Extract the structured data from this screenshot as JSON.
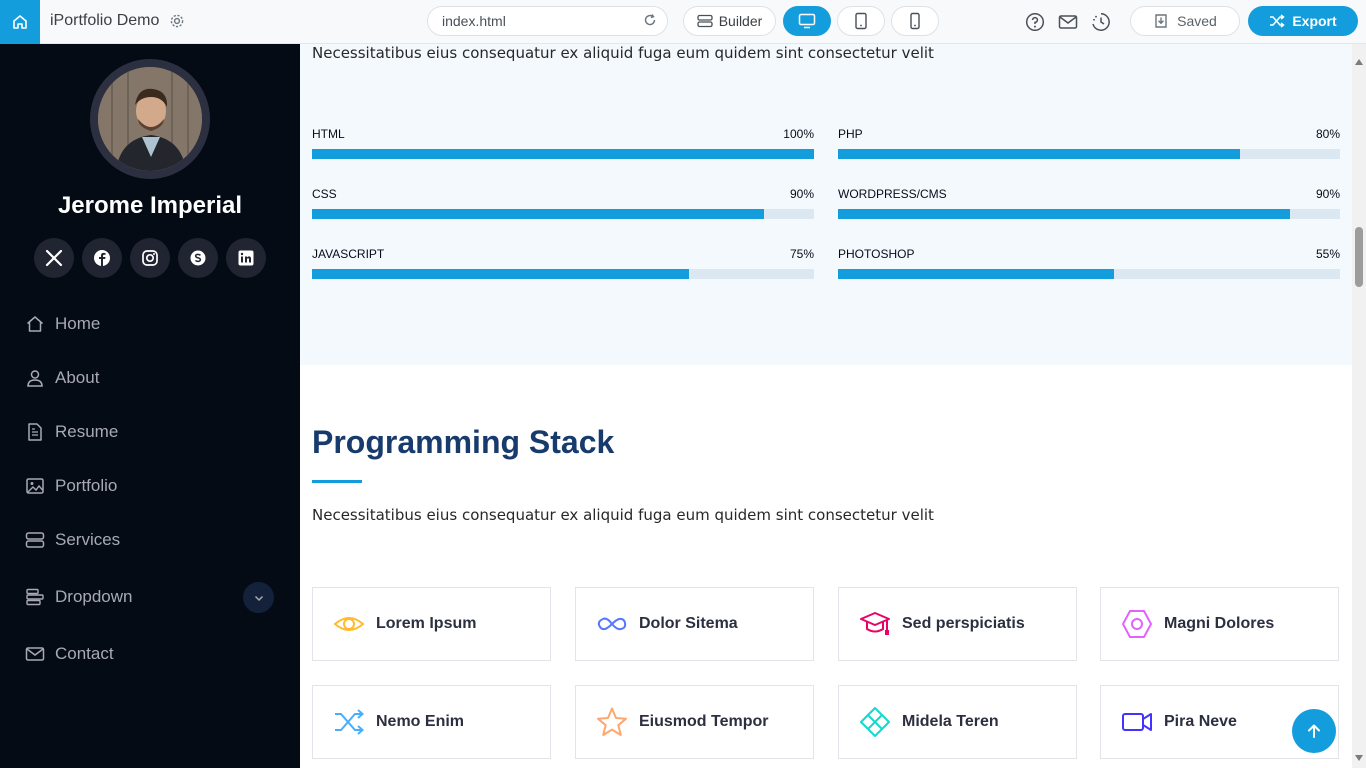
{
  "topbar": {
    "app_title": "iPortfolio Demo",
    "url": "index.html",
    "builder_label": "Builder",
    "saved_label": "Saved",
    "export_label": "Export",
    "accent": "#149ddd"
  },
  "sidebar": {
    "name": "Jerome Imperial",
    "socials": [
      "x-icon",
      "facebook-icon",
      "instagram-icon",
      "skype-icon",
      "linkedin-icon"
    ],
    "nav": [
      {
        "label": "Home",
        "icon": "home-icon"
      },
      {
        "label": "About",
        "icon": "user-icon"
      },
      {
        "label": "Resume",
        "icon": "file-icon"
      },
      {
        "label": "Portfolio",
        "icon": "image-icon"
      },
      {
        "label": "Services",
        "icon": "server-icon"
      },
      {
        "label": "Dropdown",
        "icon": "menu-icon"
      },
      {
        "label": "Contact",
        "icon": "envelope-icon"
      }
    ]
  },
  "skills": {
    "description": "Necessitatibus eius consequatur ex aliquid fuga eum quidem sint consectetur velit",
    "items": [
      {
        "name": "HTML",
        "percent": 100,
        "label": "100%"
      },
      {
        "name": "PHP",
        "percent": 80,
        "label": "80%"
      },
      {
        "name": "CSS",
        "percent": 90,
        "label": "90%"
      },
      {
        "name": "WORDPRESS/CMS",
        "percent": 90,
        "label": "90%"
      },
      {
        "name": "JAVASCRIPT",
        "percent": 75,
        "label": "75%"
      },
      {
        "name": "PHOTOSHOP",
        "percent": 55,
        "label": "55%"
      }
    ]
  },
  "stack": {
    "title": "Programming Stack",
    "description": "Necessitatibus eius consequatur ex aliquid fuga eum quidem sint consectetur velit",
    "cards": [
      {
        "label": "Lorem Ipsum",
        "icon": "eye-icon",
        "color": "#ffbb2c"
      },
      {
        "label": "Dolor Sitema",
        "icon": "infinity-icon",
        "color": "#5578ff"
      },
      {
        "label": "Sed perspiciatis",
        "icon": "mortarboard-icon",
        "color": "#e80368"
      },
      {
        "label": "Magni Dolores",
        "icon": "nut-icon",
        "color": "#e361ff"
      },
      {
        "label": "Nemo Enim",
        "icon": "shuffle-icon",
        "color": "#47aeff"
      },
      {
        "label": "Eiusmod Tempor",
        "icon": "star-icon",
        "color": "#ffa76e"
      },
      {
        "label": "Midela Teren",
        "icon": "diamond-icon",
        "color": "#11dbcf"
      },
      {
        "label": "Pira Neve",
        "icon": "camera-video-icon",
        "color": "#4233ff"
      }
    ]
  }
}
